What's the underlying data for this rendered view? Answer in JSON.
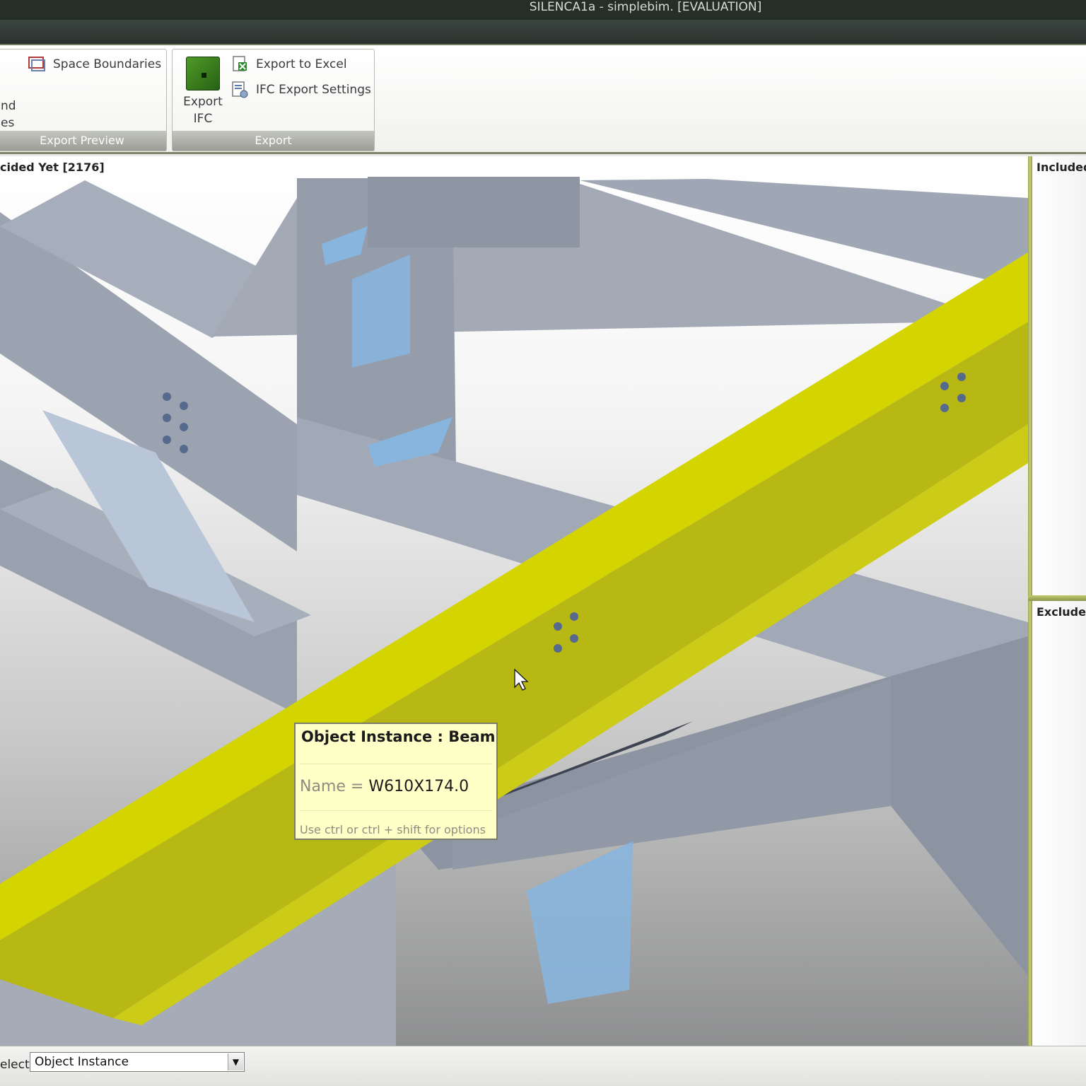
{
  "window": {
    "title": "SILENCA1a - simplebim. [EVALUATION]"
  },
  "ribbon": {
    "export_preview_group": {
      "label": "Export Preview",
      "space_boundaries": "Space Boundaries",
      "cut_text_1": "nd",
      "cut_text_2": "es"
    },
    "export_group": {
      "label": "Export",
      "export_ifc_line1": "Export",
      "export_ifc_line2": "IFC",
      "export_to_excel": "Export to Excel",
      "ifc_export_settings": "IFC Export Settings"
    }
  },
  "viewport": {
    "title": "cided Yet [2176]",
    "highlight_color": "#c8c800"
  },
  "tooltip": {
    "title": "Object Instance : Beam",
    "name_key": "Name =",
    "name_value": "W610X174.0",
    "hint": "Use ctrl or ctrl + shift for options"
  },
  "side_panels": {
    "included_title": "Included",
    "excluded_title": "Excluded"
  },
  "statusbar": {
    "select_label": "elect:",
    "select_value": "Object Instance"
  },
  "icons": [
    "space-boundaries-icon",
    "export-ifc-icon",
    "excel-icon",
    "settings-icon",
    "mouse-cursor-icon",
    "chevron-down-icon"
  ]
}
